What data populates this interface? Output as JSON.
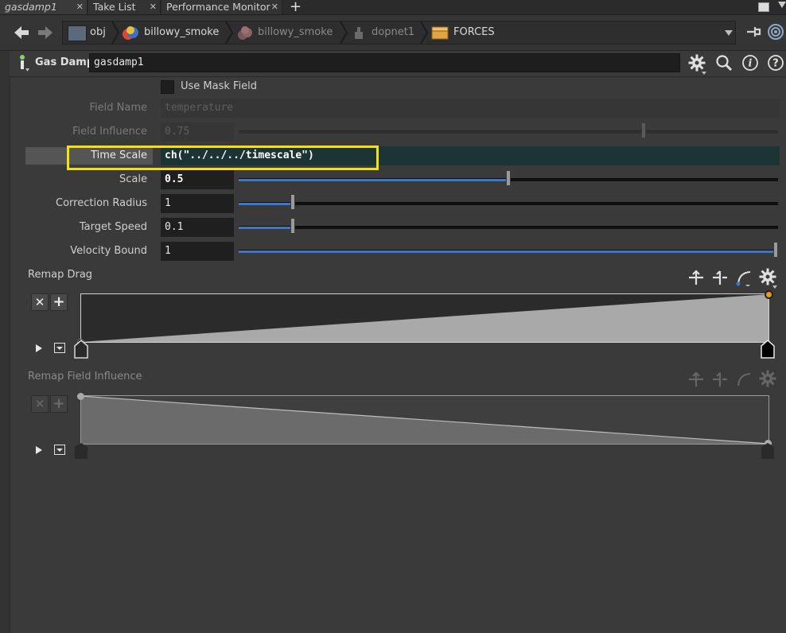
{
  "tabs": [
    {
      "label": "gasdamp1",
      "active": true
    },
    {
      "label": "Take List",
      "active": false
    },
    {
      "label": "Performance Monitor",
      "active": false
    }
  ],
  "tab_add": "+",
  "breadcrumb": [
    {
      "label": "obj",
      "dim": false
    },
    {
      "label": "billowy_smoke",
      "dim": false
    },
    {
      "label": "billowy_smoke",
      "dim": true
    },
    {
      "label": "dopnet1",
      "dim": true
    },
    {
      "label": "FORCES",
      "dim": false
    }
  ],
  "node": {
    "type": "Gas Damp",
    "name": "gasdamp1"
  },
  "params": {
    "use_mask_field": "Use Mask Field",
    "field_name": {
      "label": "Field Name",
      "value": "temperature"
    },
    "field_influence": {
      "label": "Field Influence",
      "value": "0.75",
      "fraction": 0.75
    },
    "time_scale": {
      "label": "Time Scale",
      "value": "ch(\"../../../timescale\")"
    },
    "scale": {
      "label": "Scale",
      "value": "0.5",
      "fraction": 0.5
    },
    "correction_radius": {
      "label": "Correction Radius",
      "value": "1",
      "fraction": 0.1
    },
    "target_speed": {
      "label": "Target Speed",
      "value": "0.1",
      "fraction": 0.1
    },
    "velocity_bound": {
      "label": "Velocity Bound",
      "value": "1",
      "fraction": 1.0
    }
  },
  "remap_drag": {
    "label": "Remap Drag",
    "start": 0.0,
    "end": 1.0
  },
  "remap_field_influence": {
    "label": "Remap Field Influence",
    "start": 1.0,
    "end": 0.0
  },
  "colors": {
    "highlight": "#f5e400",
    "expr_bg": "#1d3434",
    "slider_fill": "#3d78c6"
  }
}
